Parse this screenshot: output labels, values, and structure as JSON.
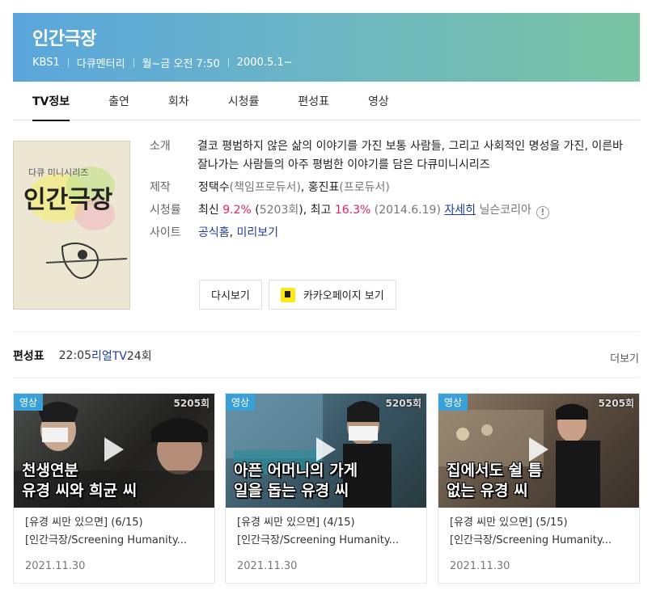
{
  "header": {
    "title": "인간극장",
    "channel": "KBS1",
    "genre": "다큐멘터리",
    "airtime": "월~금 오전 7:50",
    "start_date": "2000.5.1~"
  },
  "tabs": [
    {
      "label": "TV정보",
      "active": true
    },
    {
      "label": "출연"
    },
    {
      "label": "회차"
    },
    {
      "label": "시청률"
    },
    {
      "label": "편성표"
    },
    {
      "label": "영상"
    }
  ],
  "poster": {
    "series_text": "다큐 미니시리즈",
    "title_text": "인간극장"
  },
  "info": {
    "intro_label": "소개",
    "intro_text": "결코 평범하지 않은 삶의 이야기를 가진 보통 사람들, 그리고 사회적인 명성을 가진, 이른바 잘나가는 사람들의 아주 평범한 이야기를 담은 다큐미니시리즈",
    "production_label": "제작",
    "production": {
      "name1": "정택수",
      "role1": "(책임프로듀서)",
      "sep": ", ",
      "name2": "홍진표",
      "role2": "(프로듀서)"
    },
    "ratings_label": "시청률",
    "ratings": {
      "latest_prefix": "최신 ",
      "latest_value": "9.2%",
      "latest_ep_open": " (",
      "latest_ep": "5203회",
      "latest_ep_close": "), 최고 ",
      "best_value": "16.3%",
      "best_date": " (2014.6.19) ",
      "detail_link": "자세히",
      "source": " 닐슨코리아",
      "help_icon": "!"
    },
    "site_label": "사이트",
    "site_links": {
      "official": "공식홈",
      "sep": ", ",
      "preview": "미리보기"
    }
  },
  "buttons": {
    "replay": "다시보기",
    "kakao": "카카오페이지 보기"
  },
  "schedule": {
    "header": "편성표",
    "time": "22:05 ",
    "channel": "리얼TV",
    "episode": " 24회",
    "more": "더보기"
  },
  "videos": [
    {
      "badge": "영상",
      "episode_mark": "5205회",
      "caption_line1": "천생연분",
      "caption_line2": "유경 씨와 희균 씨",
      "title_line1": "[유경 씨만 있으면] (6/15)",
      "title_line2": "[인간극장/Screening Humanity...",
      "date": "2021.11.30",
      "theme": "#2a2c2b"
    },
    {
      "badge": "영상",
      "episode_mark": "5205회",
      "caption_line1": "아픈 어머니의 가게",
      "caption_line2": "일을 돕는 유경 씨",
      "title_line1": "[유경 씨만 있으면] (4/15)",
      "title_line2": "[인간극장/Screening Humanity...",
      "date": "2021.11.30",
      "theme": "#3c5d6e"
    },
    {
      "badge": "영상",
      "episode_mark": "5205회",
      "caption_line1": "집에서도 쉴 틈",
      "caption_line2": "없는 유경 씨",
      "title_line1": "[유경 씨만 있으면] (5/15)",
      "title_line2": "[인간극장/Screening Humanity...",
      "date": "2021.11.30",
      "theme": "#6b5d4b"
    }
  ]
}
